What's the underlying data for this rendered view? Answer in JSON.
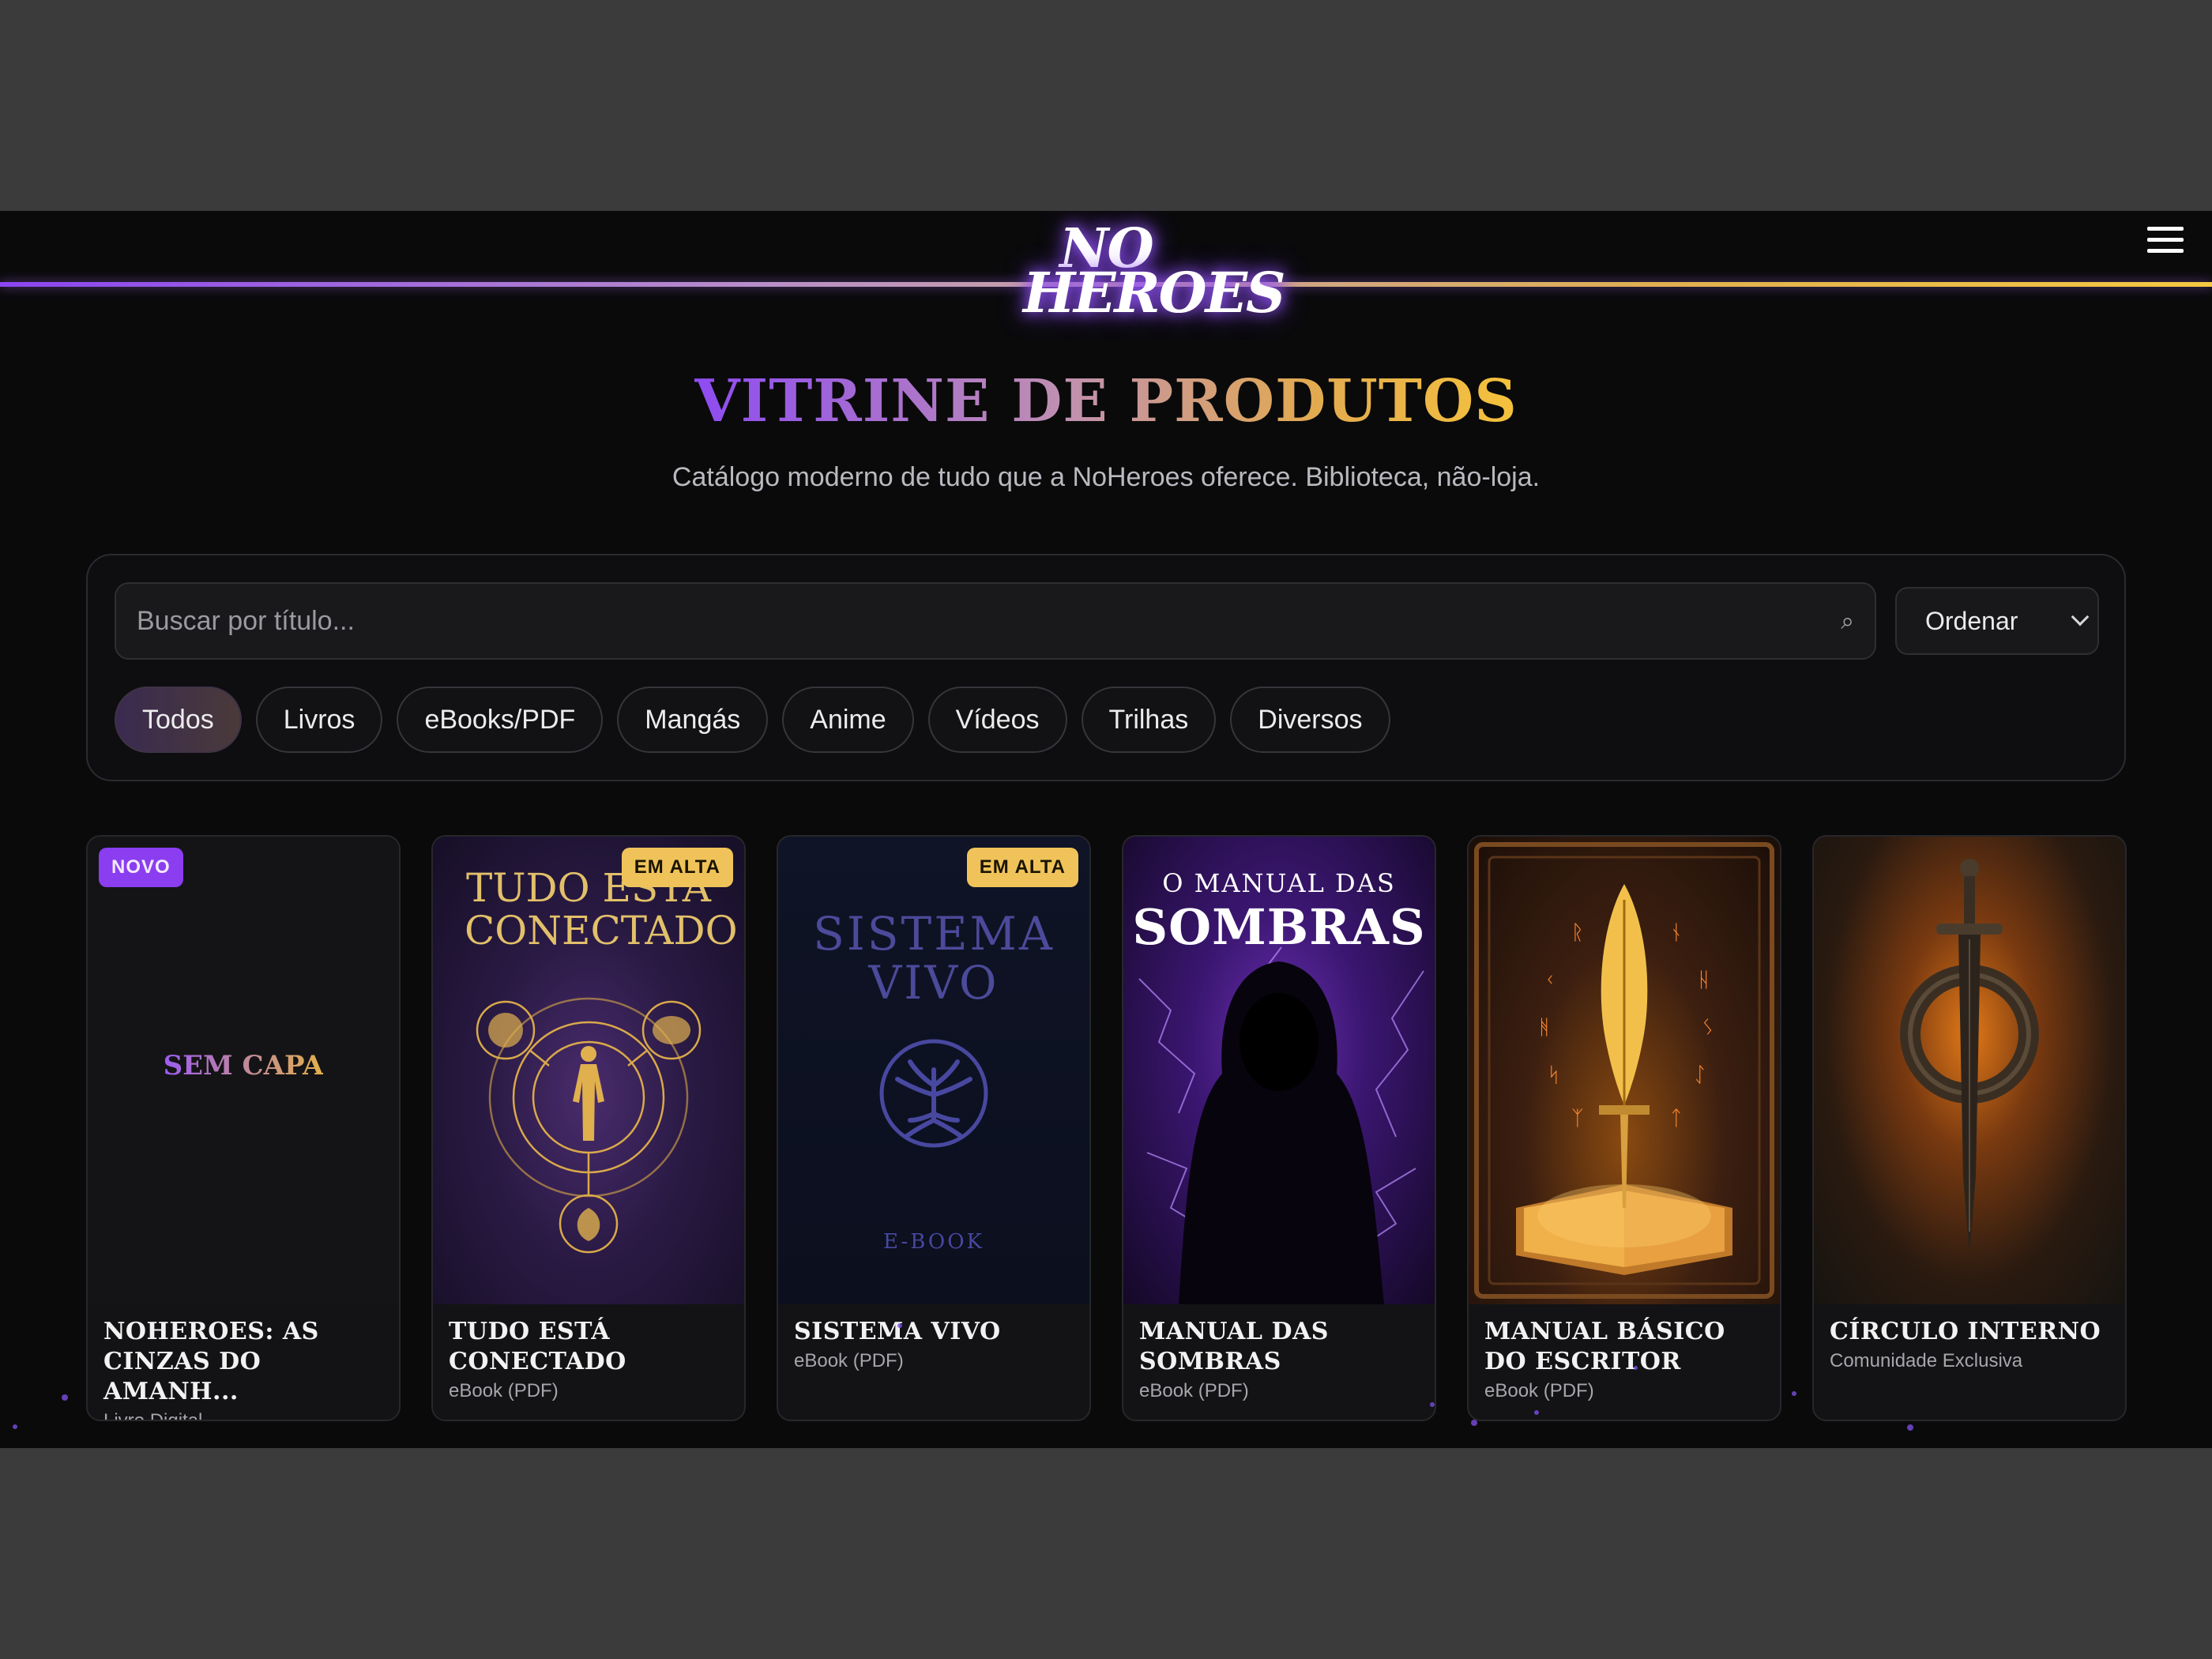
{
  "brand": {
    "logo_line1": "NO",
    "logo_line2": "HEROES"
  },
  "header": {
    "title": "VITRINE DE PRODUTOS",
    "subtitle": "Catálogo moderno de tudo que a NoHeroes oferece. Biblioteca, não-loja."
  },
  "search": {
    "placeholder": "Buscar por título...",
    "value": ""
  },
  "sort": {
    "selected": "Ordenar"
  },
  "filters": [
    {
      "label": "Todos",
      "active": true
    },
    {
      "label": "Livros",
      "active": false
    },
    {
      "label": "eBooks/PDF",
      "active": false
    },
    {
      "label": "Mangás",
      "active": false
    },
    {
      "label": "Anime",
      "active": false
    },
    {
      "label": "Vídeos",
      "active": false
    },
    {
      "label": "Trilhas",
      "active": false
    },
    {
      "label": "Diversos",
      "active": false
    }
  ],
  "products": [
    {
      "title": "NOHEROES: AS CINZAS DO AMANH...",
      "type": "Livro Digital",
      "badge": "NOVO",
      "cover_placeholder": "SEM CAPA"
    },
    {
      "title": "TUDO ESTÁ CONECTADO",
      "type": "eBook (PDF)",
      "badge": "EM ALTA",
      "cover_text": "TUDO ESTÁ CONECTADO"
    },
    {
      "title": "SISTEMA VIVO",
      "type": "eBook (PDF)",
      "badge": "EM ALTA",
      "cover_text_line1": "SISTEMA",
      "cover_text_line2": "VIVO",
      "cover_caption": "E-BOOK"
    },
    {
      "title": "MANUAL DAS SOMBRAS",
      "type": "eBook (PDF)",
      "badge": "",
      "cover_text_line1": "O MANUAL DAS",
      "cover_text_line2": "SOMBRAS"
    },
    {
      "title": "MANUAL BÁSICO DO ESCRITOR",
      "type": "eBook (PDF)",
      "badge": ""
    },
    {
      "title": "CÍRCULO INTERNO",
      "type": "Comunidade Exclusiva",
      "badge": ""
    }
  ],
  "colors": {
    "accent_purple": "#8b45f0",
    "accent_gold": "#f5c842",
    "background": "#0a0a0b"
  }
}
